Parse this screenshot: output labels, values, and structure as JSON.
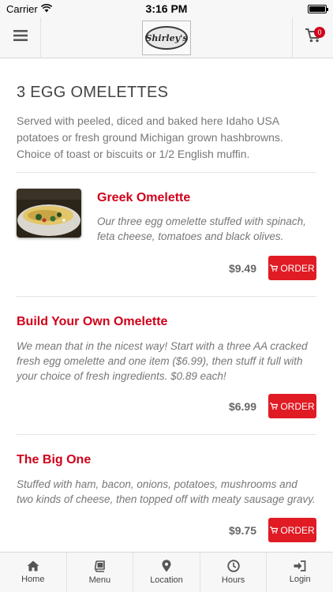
{
  "status_bar": {
    "carrier": "Carrier",
    "time": "3:16 PM"
  },
  "header": {
    "logo_text": "Shirley's",
    "cart_count": "0"
  },
  "section": {
    "title": "3 EGG OMELETTES",
    "description": "Served with peeled, diced and baked here Idaho USA potatoes or fresh ground Michigan grown hashbrowns. Choice of toast or biscuits or 1/2 English muffin."
  },
  "items": [
    {
      "name": "Greek Omelette",
      "description": "Our three egg omelette stuffed with spinach, feta cheese, tomatoes and black olives.",
      "price": "$9.49",
      "order_label": "ORDER"
    },
    {
      "name": "Build Your Own Omelette",
      "description": "We mean that in the nicest way! Start with a three AA cracked fresh egg omelette and one item ($6.99), then stuff it full with your choice of fresh ingredients. $0.89 each!",
      "price": "$6.99",
      "order_label": "ORDER"
    },
    {
      "name": "The Big One",
      "description": "Stuffed with ham, bacon, onions, potatoes, mushrooms and two kinds of cheese, then topped off with meaty sausage gravy.",
      "price": "$9.75",
      "order_label": "ORDER"
    }
  ],
  "tabs": [
    {
      "label": "Home",
      "icon": "home-icon"
    },
    {
      "label": "Menu",
      "icon": "book-icon"
    },
    {
      "label": "Location",
      "icon": "map-pin-icon"
    },
    {
      "label": "Hours",
      "icon": "clock-icon"
    },
    {
      "label": "Login",
      "icon": "login-icon"
    }
  ],
  "colors": {
    "accent": "#d0021b",
    "button": "#e01b24",
    "bar_bg": "#f7f7f7"
  }
}
